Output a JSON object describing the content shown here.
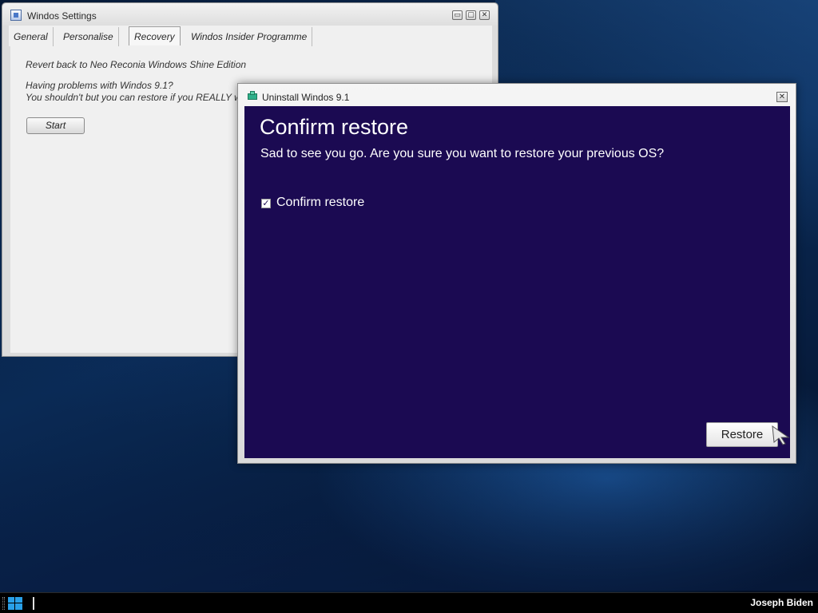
{
  "settings_window": {
    "title": "Windos Settings",
    "controls": {
      "minimize": "▭",
      "maximize": "▢",
      "close": "✕"
    },
    "tabs": [
      {
        "label": "General"
      },
      {
        "label": "Personalise"
      },
      {
        "label": "Recovery",
        "active": true
      },
      {
        "label": "Windos Insider Programme"
      }
    ],
    "body": {
      "revert_text": "Revert back to Neo Reconia Windows Shine Edition",
      "problem_line1": "Having problems with Windos 9.1?",
      "problem_line2": "You shouldn't but you can restore if you REALLY want",
      "start_button": "Start"
    }
  },
  "uninstall_dialog": {
    "title": "Uninstall Windos 9.1",
    "close_glyph": "✕",
    "heading": "Confirm restore",
    "subtitle": "Sad to see you go. Are you sure you want to restore your previous OS?",
    "checkbox": {
      "label": "Confirm restore",
      "checked": true,
      "glyph": "✓"
    },
    "restore_button": "Restore",
    "background_color": "#1b0a52"
  },
  "taskbar": {
    "start_icon": "windows-logo-icon",
    "user_name": "Joseph Biden"
  }
}
